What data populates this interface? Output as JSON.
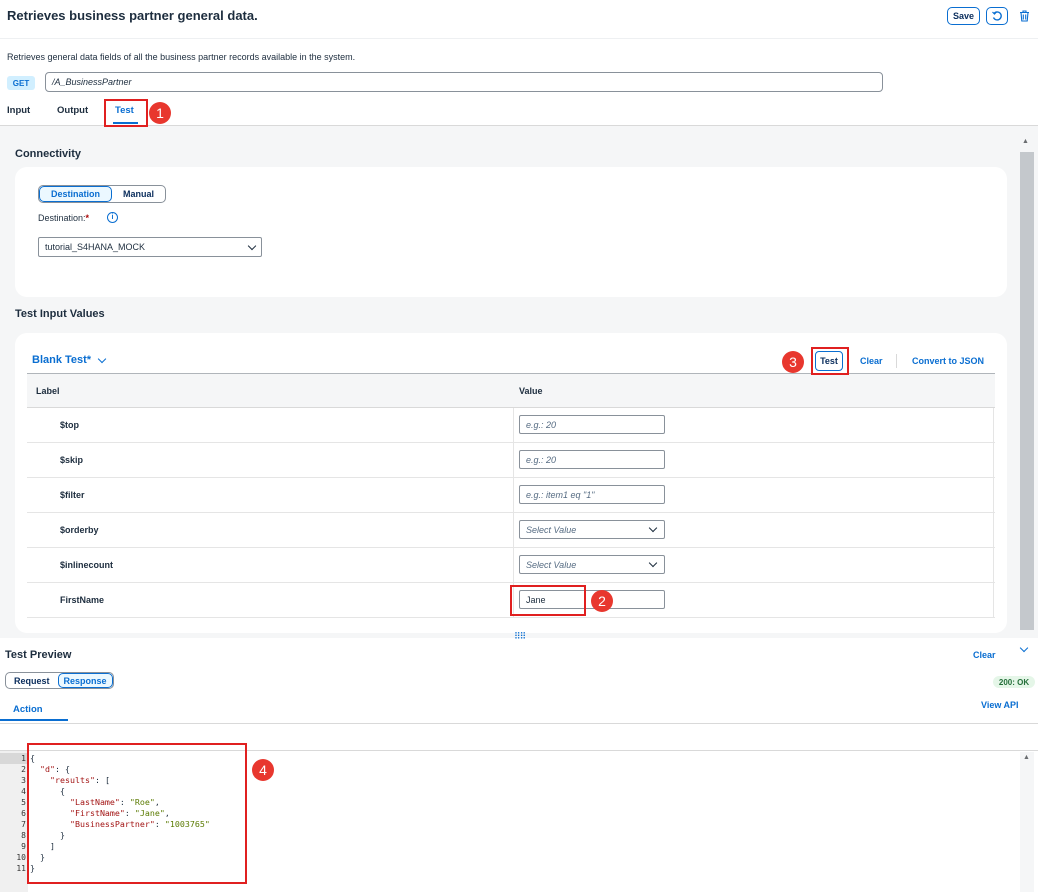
{
  "header": {
    "title": "Retrieves business partner general data.",
    "save_label": "Save",
    "description": "Retrieves general data fields of all the business partner records available in the system.",
    "method": "GET",
    "path": "/A_BusinessPartner"
  },
  "tabs": [
    {
      "label": "Input"
    },
    {
      "label": "Output"
    },
    {
      "label": "Test"
    }
  ],
  "annotations": [
    "1",
    "2",
    "3",
    "4"
  ],
  "connectivity": {
    "title": "Connectivity",
    "modes": [
      "Destination",
      "Manual"
    ],
    "destination_label": "Destination:",
    "required_mark": "*",
    "destination_value": "tutorial_S4HANA_MOCK"
  },
  "test_input": {
    "title": "Test Input Values",
    "variant": "Blank Test*",
    "test_label": "Test",
    "clear_label": "Clear",
    "json_label": "Convert to JSON",
    "columns": [
      "Label",
      "Value"
    ],
    "rows": [
      {
        "label": "$top",
        "placeholder": "e.g.: 20",
        "value": ""
      },
      {
        "label": "$skip",
        "placeholder": "e.g.: 20",
        "value": ""
      },
      {
        "label": "$filter",
        "placeholder": "e.g.: item1 eq \"1\"",
        "value": ""
      },
      {
        "label": "$orderby",
        "placeholder": "Select Value",
        "value": ""
      },
      {
        "label": "$inlinecount",
        "placeholder": "Select Value",
        "value": ""
      },
      {
        "label": "FirstName",
        "placeholder": "",
        "value": "Jane"
      }
    ]
  },
  "preview": {
    "title": "Test Preview",
    "clear_label": "Clear",
    "modes": [
      "Request",
      "Response"
    ],
    "status": "200: OK",
    "action_tab": "Action",
    "view_api": "View API",
    "line_numbers": [
      "1",
      "2",
      "3",
      "4",
      "5",
      "6",
      "7",
      "8",
      "9",
      "10",
      "11"
    ],
    "code_lines": [
      "{",
      "  \"d\": {",
      "    \"results\": [",
      "      {",
      "        \"LastName\": \"Roe\",",
      "        \"FirstName\": \"Jane\",",
      "        \"BusinessPartner\": \"1003765\"",
      "      }",
      "    ]",
      "  }",
      "}"
    ]
  },
  "colors": {
    "accent": "#0a6ed1",
    "annotation": "#e8372e",
    "ok": "#256f3a"
  }
}
